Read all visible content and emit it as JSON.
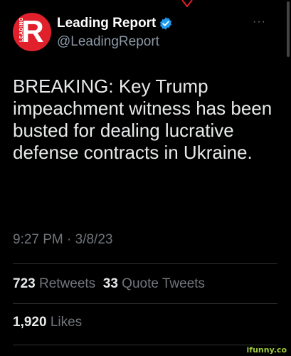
{
  "profile": {
    "display_name": "Leading Report",
    "handle": "@LeadingReport",
    "avatar_letter": "R",
    "avatar_side_text": "LEADING",
    "verified": true
  },
  "tweet": {
    "text": "BREAKING: Key Trump impeachment witness has been busted for dealing lucrative defense contracts in Ukraine.",
    "time": "9:27 PM · 3/8/23"
  },
  "stats": {
    "retweets_count": "723",
    "retweets_label": "Retweets",
    "quotes_count": "33",
    "quotes_label": "Quote Tweets",
    "likes_count": "1,920",
    "likes_label": "Likes"
  },
  "more_icon": "···",
  "watermark": "ifunny.co",
  "colors": {
    "background": "#000000",
    "text": "#e7e9ea",
    "muted": "#71767b",
    "verified": "#1d9bf0",
    "avatar": "#e0212b",
    "watermark": "#9fc93c"
  }
}
